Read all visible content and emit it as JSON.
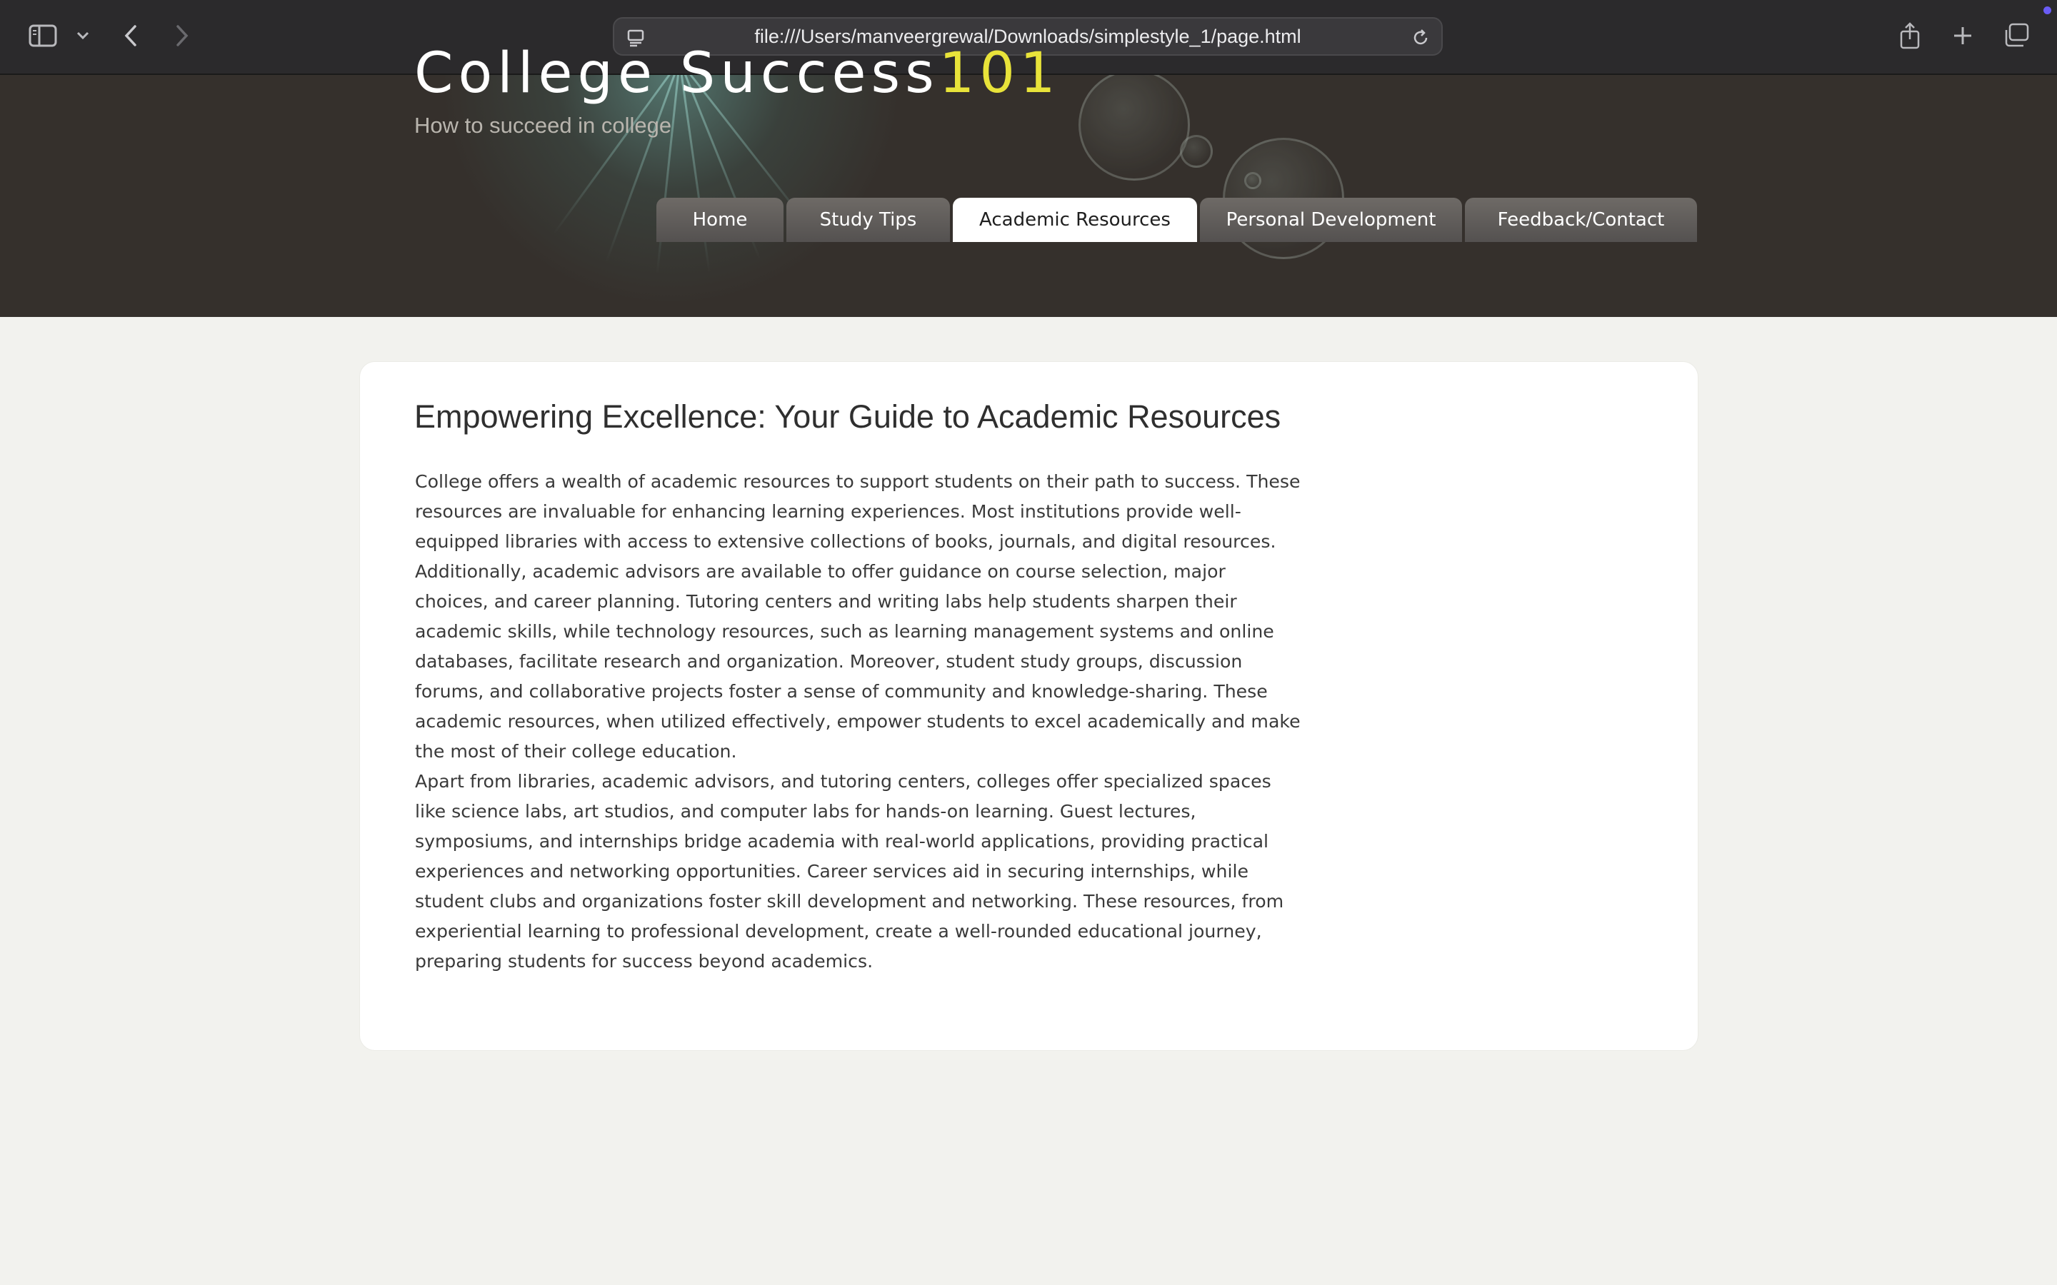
{
  "browser": {
    "url": "file:///Users/manveergrewal/Downloads/simplestyle_1/page.html",
    "icons": [
      "sidebar-icon",
      "chevron-down-icon",
      "back-icon",
      "forward-icon",
      "page-menu-icon",
      "reload-icon",
      "share-icon",
      "new-tab-icon",
      "tab-overview-icon"
    ]
  },
  "header": {
    "title_main": "College Success",
    "title_accent": "101",
    "tagline": "How to succeed in college",
    "accent_color": "#e8e33a"
  },
  "nav": {
    "items": [
      {
        "label": "Home",
        "active": false
      },
      {
        "label": "Study Tips",
        "active": false
      },
      {
        "label": "Academic Resources",
        "active": true
      },
      {
        "label": "Personal Development",
        "active": false
      },
      {
        "label": "Feedback/Contact",
        "active": false
      }
    ]
  },
  "main": {
    "heading": "Empowering Excellence: Your Guide to Academic Resources",
    "paragraphs": [
      "College offers a wealth of academic resources to support students on their path to success. These resources are invaluable for enhancing learning experiences. Most institutions provide well-equipped libraries with access to extensive collections of books, journals, and digital resources. Additionally, academic advisors are available to offer guidance on course selection, major choices, and career planning. Tutoring centers and writing labs help students sharpen their academic skills, while technology resources, such as learning management systems and online databases, facilitate research and organization. Moreover, student study groups, discussion forums, and collaborative projects foster a sense of community and knowledge-sharing. These academic resources, when utilized effectively, empower students to excel academically and make the most of their college education.",
      "Apart from libraries, academic advisors, and tutoring centers, colleges offer specialized spaces like science labs, art studios, and computer labs for hands-on learning. Guest lectures, symposiums, and internships bridge academia with real-world applications, providing practical experiences and networking opportunities. Career services aid in securing internships, while student clubs and organizations foster skill development and networking. These resources, from experiential learning to professional development, create a well-rounded educational journey, preparing students for success beyond academics."
    ]
  }
}
